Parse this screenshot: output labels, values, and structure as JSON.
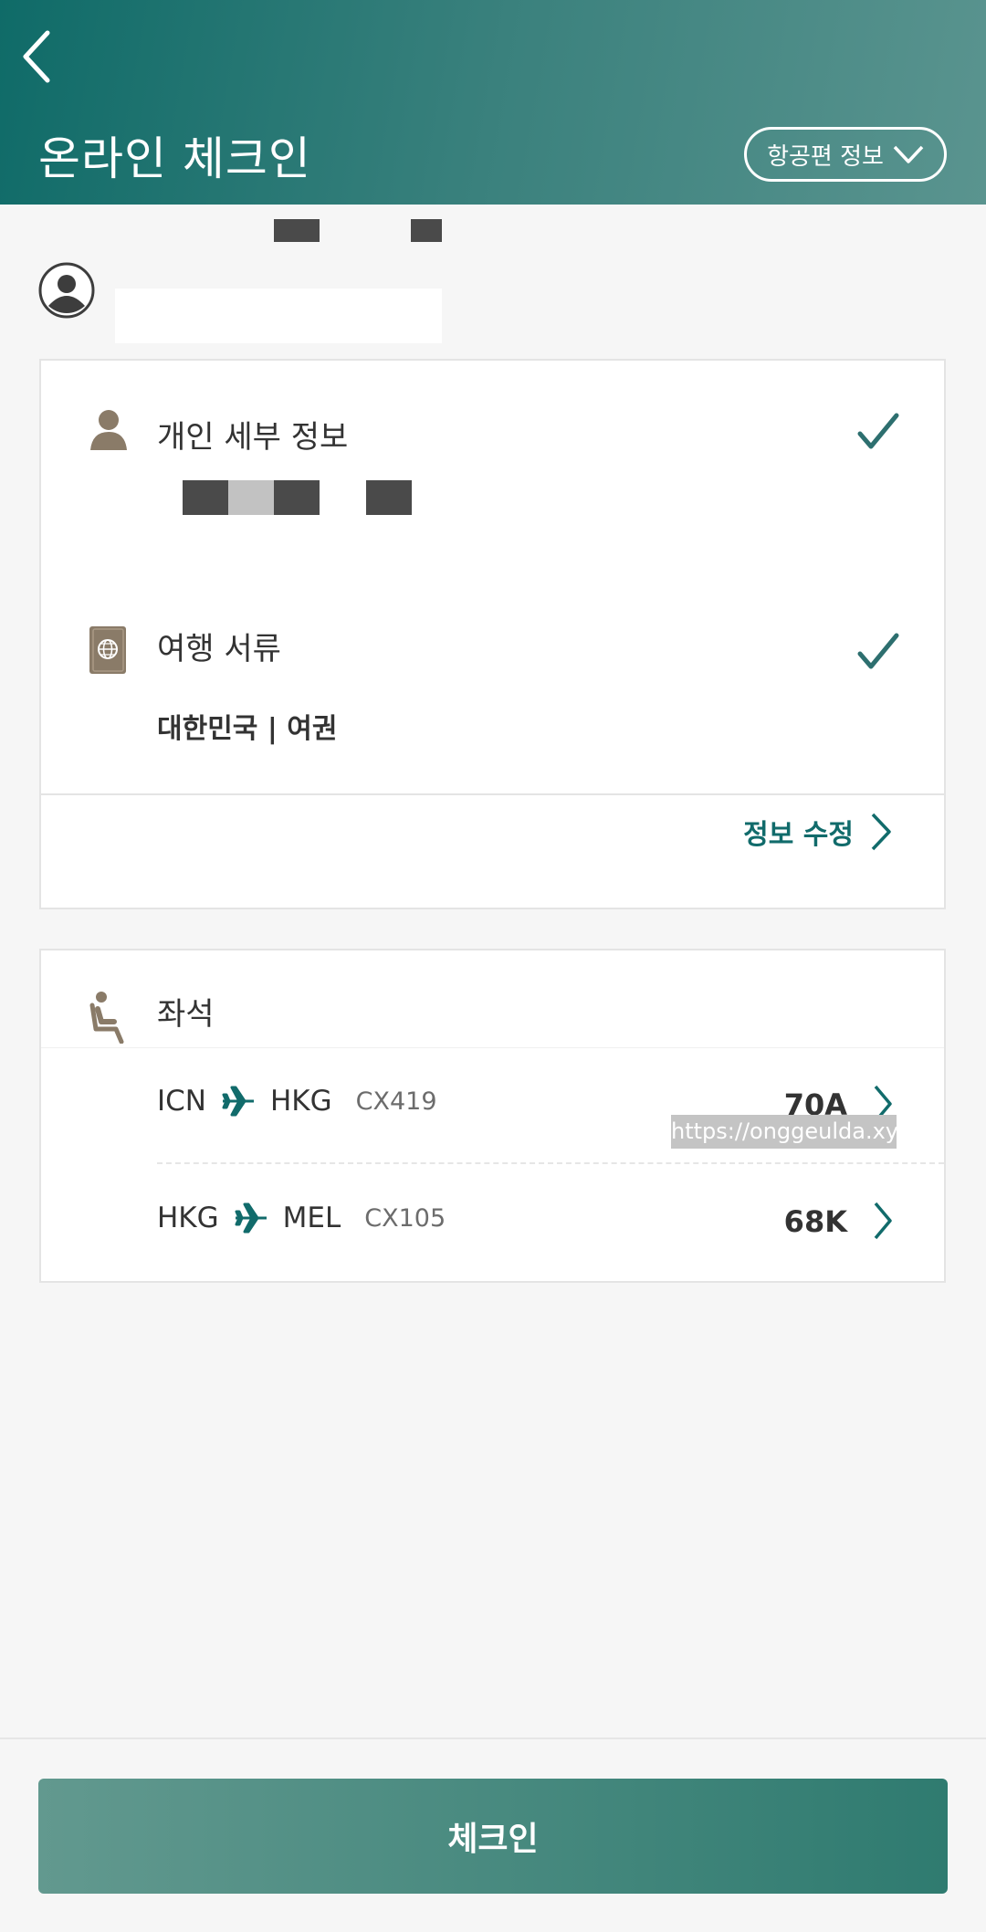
{
  "header": {
    "title": "온라인 체크인",
    "flight_info_label": "항공편 정보"
  },
  "personal": {
    "title": "개인 세부 정보"
  },
  "documents": {
    "title": "여행 서류",
    "value": "대한민국 | 여권"
  },
  "edit": {
    "label": "정보 수정"
  },
  "seats": {
    "title": "좌석",
    "rows": [
      {
        "from": "ICN",
        "to": "HKG",
        "flight": "CX419",
        "seat": "70A"
      },
      {
        "from": "HKG",
        "to": "MEL",
        "flight": "CX105",
        "seat": "68K"
      }
    ]
  },
  "watermark": "https://onggeulda.xyz",
  "footer": {
    "checkin_label": "체크인"
  },
  "colors": {
    "header_start": "#0f6b68",
    "header_end": "#5a948f",
    "accent": "#116b6b",
    "icon_taupe": "#8a7b68",
    "button_start": "#62998f",
    "button_end": "#2f7b70"
  }
}
